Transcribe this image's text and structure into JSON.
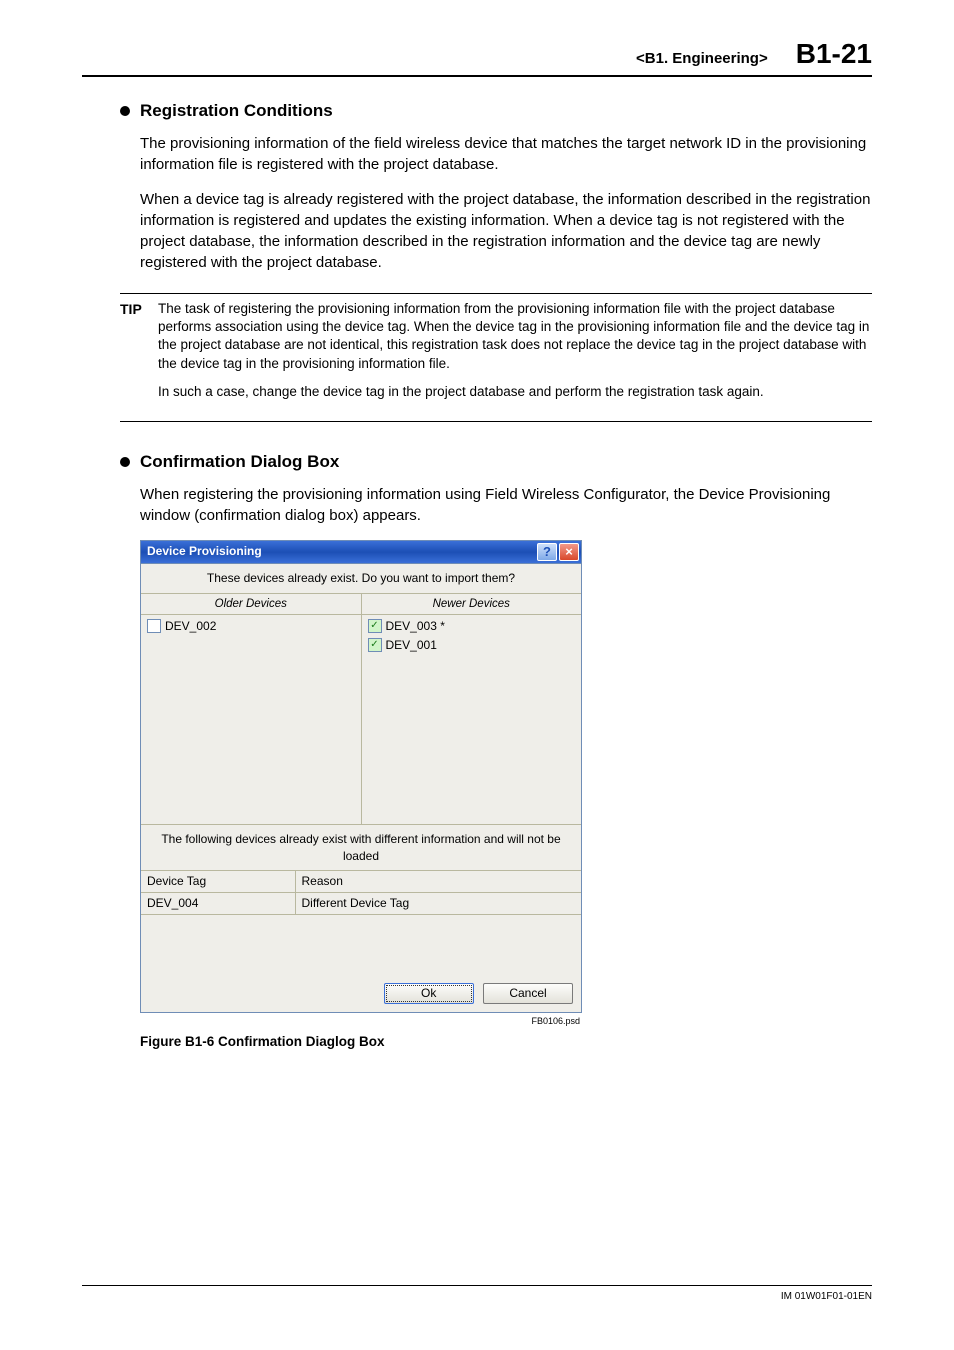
{
  "header": {
    "section": "<B1.  Engineering>",
    "page": "B1-21"
  },
  "sec1": {
    "title": "Registration Conditions",
    "p1": "The provisioning information of the field wireless device that matches the target network ID in the provisioning information file is registered with the project database.",
    "p2": "When a device tag is already registered with the project database, the information described in the registration information is registered and updates the existing information. When a device tag is not registered with the project database, the information described in the registration information and the device tag are newly registered with the project database."
  },
  "tip": {
    "label": "TIP",
    "p1": "The task of registering the provisioning information from the provisioning information file with the project database performs association using the device tag. When the device tag in the provisioning information file and the device tag in the project database are not identical, this registration task does not replace the device tag in the project database with the device tag in the provisioning information file.",
    "p2": "In such a case, change the device tag in the project database and perform the registration task again."
  },
  "sec2": {
    "title": "Confirmation Dialog Box",
    "p1": "When registering the provisioning information using Field Wireless Configurator, the Device Provisioning window (confirmation dialog box) appears."
  },
  "dialog": {
    "title": "Device Provisioning",
    "help_glyph": "?",
    "close_glyph": "×",
    "question": "These devices already exist. Do you want to import them?",
    "col_older": "Older Devices",
    "col_newer": "Newer Devices",
    "older_items": [
      {
        "label": "DEV_002",
        "checked": false
      }
    ],
    "newer_items": [
      {
        "label": "DEV_003 *",
        "checked": true
      },
      {
        "label": "DEV_001",
        "checked": true
      }
    ],
    "msg2": "The following devices already exist with different information and will not be loaded",
    "tbl_h1": "Device Tag",
    "tbl_h2": "Reason",
    "tbl_r1c1": "DEV_004",
    "tbl_r1c2": "Different Device Tag",
    "ok": "Ok",
    "cancel": "Cancel"
  },
  "figure": {
    "file": "FB0106.psd",
    "caption": "Figure B1-6 Confirmation Diaglog Box"
  },
  "footer": {
    "doc": "IM 01W01F01-01EN"
  }
}
